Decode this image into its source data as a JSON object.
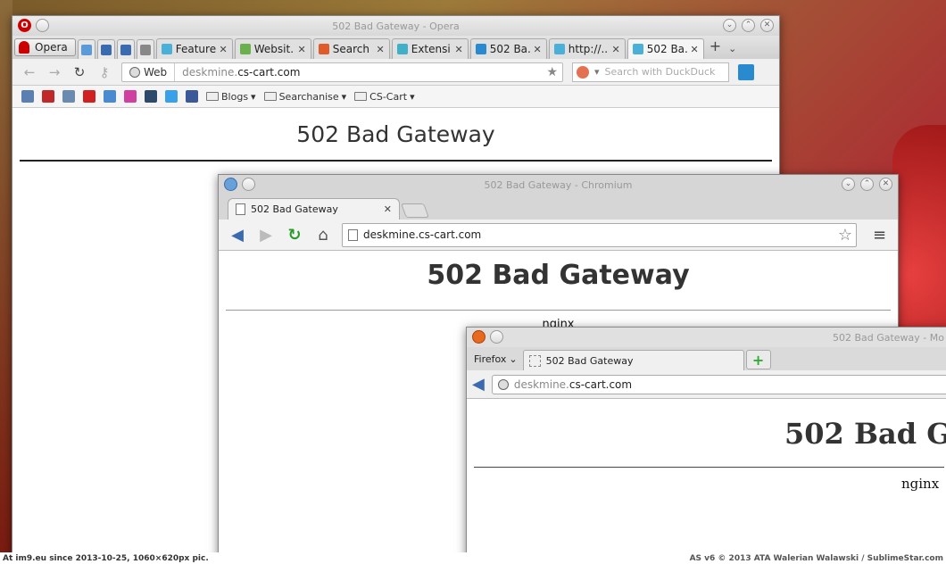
{
  "opera": {
    "title": "502 Bad Gateway - Opera",
    "menu_label": "Opera",
    "tabs": [
      {
        "label": "Feature...",
        "color": "#4ab0d8"
      },
      {
        "label": "Websit...",
        "color": "#6ab04c"
      },
      {
        "label": "Search ...",
        "color": "#e05a2a"
      },
      {
        "label": "Extensi...",
        "color": "#3fb0c8"
      },
      {
        "label": "502 Ba...",
        "color": "#2a8ad0"
      },
      {
        "label": "http://...",
        "color": "#4ab0d8"
      },
      {
        "label": "502 Ba...",
        "color": "#4ab0d8"
      }
    ],
    "address_chip": "Web",
    "url_prefix": "deskmine.",
    "url_domain": "cs-cart.com",
    "search_placeholder": "Search with DuckDuck",
    "bookmarks": [
      "Blogs",
      "Searchanise",
      "CS-Cart"
    ],
    "page_heading": "502 Bad Gateway"
  },
  "chromium": {
    "title": "502 Bad Gateway - Chromium",
    "tab_label": "502 Bad Gateway",
    "url": "deskmine.cs-cart.com",
    "page_heading": "502 Bad Gateway",
    "server": "nginx"
  },
  "firefox": {
    "title": "502 Bad Gateway - Mo",
    "menu_label": "Firefox",
    "tab_label": "502 Bad Gateway",
    "url_prefix": "deskmine.",
    "url_domain": "cs-cart.com",
    "page_heading": "502 Bad G",
    "server": "nginx"
  },
  "footer": {
    "left": "At im9.eu  since 2013-10-25, 1060×620px pic.",
    "right": "AS v6 © 2013 ATA Walerian Walawski / SublimeStar.com"
  }
}
